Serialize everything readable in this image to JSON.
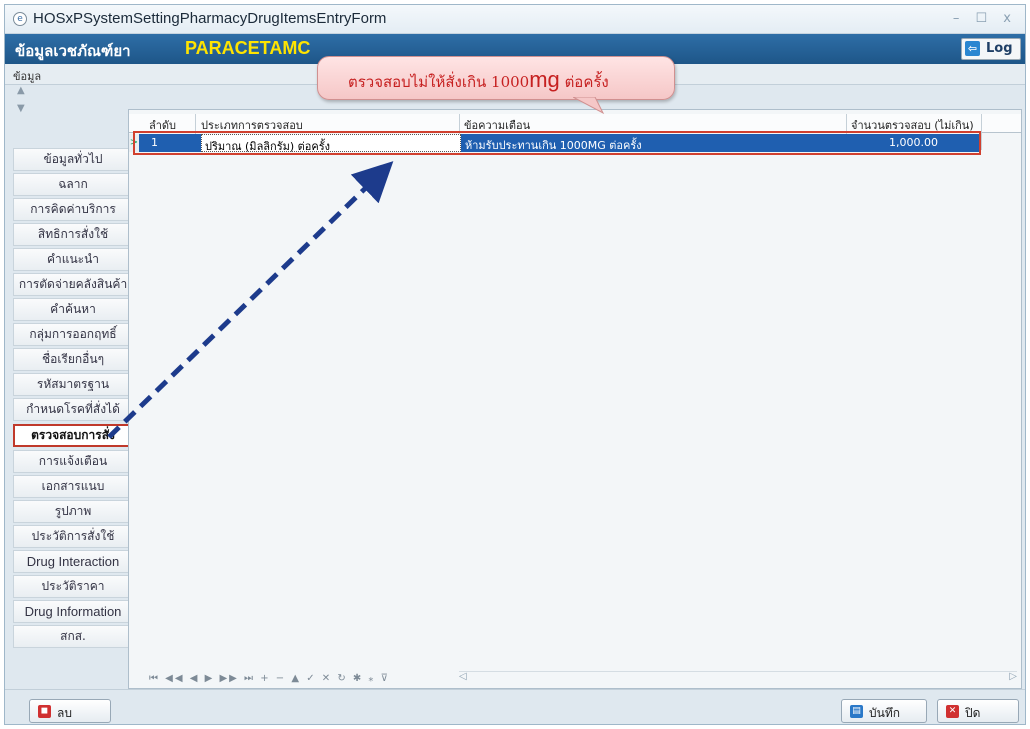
{
  "window": {
    "title": "HOSxPSystemSettingPharmacyDrugItemsEntryForm",
    "controls": "–  ☐  x"
  },
  "header": {
    "section_title": "ข้อมูลเวชภัณฑ์ยา",
    "drug_name": "PARACETAMC",
    "log_label": "Log"
  },
  "subheader": {
    "label": "ข้อมูล"
  },
  "sidebar": {
    "items": [
      {
        "label": "ข้อมูลทั่วไป"
      },
      {
        "label": "ฉลาก"
      },
      {
        "label": "การคิดค่าบริการ"
      },
      {
        "label": "สิทธิการสั่งใช้"
      },
      {
        "label": "คำแนะนำ"
      },
      {
        "label": "การตัดจ่ายคลังสินค้า"
      },
      {
        "label": "คำค้นหา"
      },
      {
        "label": "กลุ่มการออกฤทธิ์"
      },
      {
        "label": "ชื่อเรียกอื่นๆ"
      },
      {
        "label": "รหัสมาตรฐาน"
      },
      {
        "label": "กำหนดโรคที่สั่งได้"
      },
      {
        "label": "ตรวจสอบการสั่ง"
      },
      {
        "label": "การแจ้งเตือน"
      },
      {
        "label": "เอกสารแนบ"
      },
      {
        "label": "รูปภาพ"
      },
      {
        "label": "ประวัติการสั่งใช้"
      },
      {
        "label": "Drug Interaction"
      },
      {
        "label": "ประวัติราคา"
      },
      {
        "label": "Drug Information"
      },
      {
        "label": "สกส."
      }
    ],
    "selected_label": "ตรวจสอบการสั่ง"
  },
  "grid": {
    "columns": [
      "ลำดับ",
      "ประเภทการตรวจสอบ",
      "ข้อความเตือน",
      "จำนวนตรวจสอบ (ไม่เกิน)"
    ],
    "rows": [
      {
        "order": "1",
        "check_type": "ปริมาณ (มิลลิกรัม) ต่อครั้ง",
        "warning": "ห้ามรับประทานเกิน 1000MG ต่อครั้ง",
        "limit": "1,000.00"
      }
    ],
    "nav_glyphs": "⏮ ◀◀ ◀ ▶ ▶▶ ⏭ + − ▲ ✓ ✕ ↻ ✱ ⁎ ⊽"
  },
  "callout": {
    "text_before": "ตรวจสอบไม่ให้สั่งเกิน 1000",
    "text_unit": "mg",
    "text_after": " ต่อครั้ง"
  },
  "footer": {
    "delete_label": "ลบ",
    "save_label": "บันทึก",
    "close_label": "ปิด"
  },
  "colors": {
    "header_bg": "#1e5688",
    "drug_name": "#ffe400",
    "selected_row": "#1f5fb0",
    "highlight_red": "#d0402f",
    "arrow": "#1d3b8c"
  },
  "icons": [
    "window-icon",
    "log-icon",
    "delete-icon",
    "save-icon",
    "close-icon",
    "arrow-icon"
  ]
}
